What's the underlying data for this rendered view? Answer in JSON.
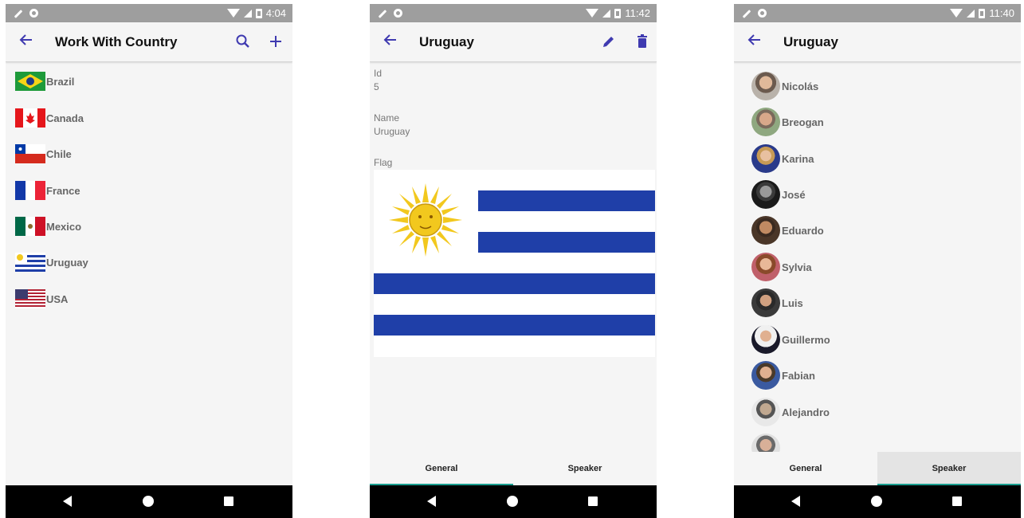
{
  "status_bars": {
    "phone1_time": "4:04",
    "phone2_time": "11:42",
    "phone3_time": "11:40"
  },
  "phone1": {
    "title": "Work With Country",
    "countries": [
      {
        "name": "Brazil"
      },
      {
        "name": "Canada"
      },
      {
        "name": "Chile"
      },
      {
        "name": "France"
      },
      {
        "name": "Mexico"
      },
      {
        "name": "Uruguay"
      },
      {
        "name": "USA"
      }
    ]
  },
  "phone2": {
    "title": "Uruguay",
    "fields": {
      "id_label": "Id",
      "id_value": "5",
      "name_label": "Name",
      "name_value": "Uruguay",
      "flag_label": "Flag"
    },
    "tabs": {
      "general": "General",
      "speaker": "Speaker"
    }
  },
  "phone3": {
    "title": "Uruguay",
    "speakers": [
      {
        "name": "Nicolás"
      },
      {
        "name": "Breogan"
      },
      {
        "name": "Karina"
      },
      {
        "name": "José"
      },
      {
        "name": "Eduardo"
      },
      {
        "name": "Sylvia"
      },
      {
        "name": "Luis"
      },
      {
        "name": "Guillermo"
      },
      {
        "name": "Fabian"
      },
      {
        "name": "Alejandro"
      }
    ],
    "tabs": {
      "general": "General",
      "speaker": "Speaker"
    }
  },
  "colors": {
    "accent": "#3f3ab0",
    "tab_indicator": "#1a9e8f",
    "status_bar": "#9e9e9e",
    "uruguay_blue": "#1f3fa8",
    "sun_yellow": "#f2c81e"
  },
  "icons": {
    "back": "arrow-left-icon",
    "search": "search-icon",
    "add": "plus-icon",
    "edit": "pencil-icon",
    "delete": "trash-icon"
  }
}
